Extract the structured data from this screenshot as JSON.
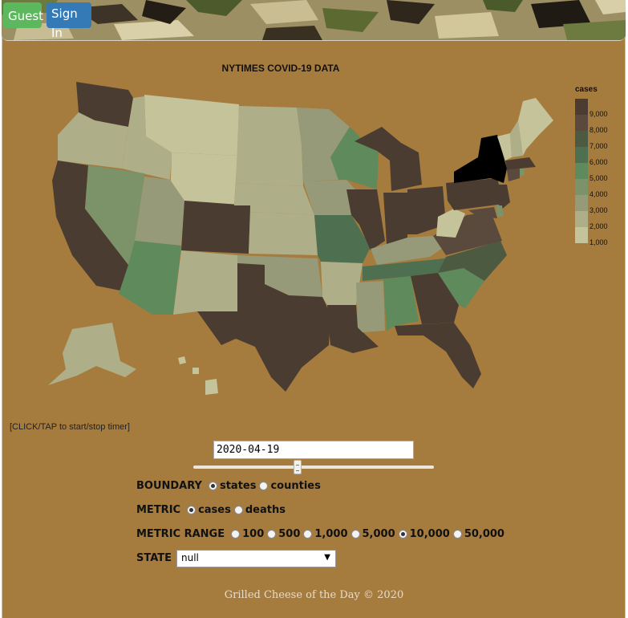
{
  "header": {
    "guest_label": "Guest",
    "signin_label": "Sign In",
    "colors": {
      "guest": "#5cb85c",
      "signin": "#337ab7"
    }
  },
  "map": {
    "title": "NYTIMES COVID-19 DATA",
    "background": "#a67b3e"
  },
  "chart_data": {
    "type": "choropleth",
    "title": "NYTIMES COVID-19 DATA",
    "metric": "cases",
    "legend": {
      "title": "cases",
      "placement": "right",
      "ticks": [
        "9,000",
        "8,000",
        "7,000",
        "6,000",
        "5,000",
        "4,000",
        "3,000",
        "2,000",
        "1,000"
      ],
      "colors": [
        "#4a3c31",
        "#5a4a3e",
        "#4b5a40",
        "#4f7050",
        "#5e8a5c",
        "#7c9268",
        "#969a78",
        "#aeaf88",
        "#c4c39a"
      ]
    }
  },
  "controls": {
    "timer_hint": "[CLICK/TAP to start/stop timer]",
    "date_value": "2020-04-19",
    "boundary": {
      "label": "BOUNDARY",
      "options": [
        {
          "label": "states",
          "checked": true
        },
        {
          "label": "counties",
          "checked": false
        }
      ]
    },
    "metric": {
      "label": "METRIC",
      "options": [
        {
          "label": "cases",
          "checked": true
        },
        {
          "label": "deaths",
          "checked": false
        }
      ]
    },
    "metric_range": {
      "label": "METRIC RANGE",
      "options": [
        {
          "label": "100",
          "checked": false
        },
        {
          "label": "500",
          "checked": false
        },
        {
          "label": "1,000",
          "checked": false
        },
        {
          "label": "5,000",
          "checked": false
        },
        {
          "label": "10,000",
          "checked": true
        },
        {
          "label": "50,000",
          "checked": false
        }
      ]
    },
    "state": {
      "label": "STATE",
      "selected": "null"
    }
  },
  "footer": {
    "text": "Grilled Cheese of the Day © 2020"
  }
}
